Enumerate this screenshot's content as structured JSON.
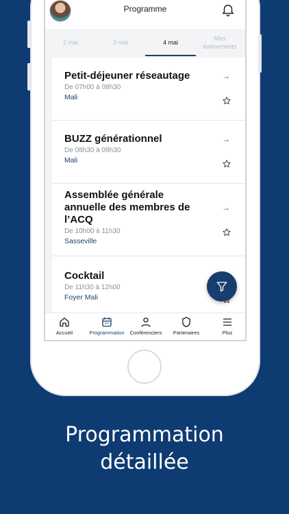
{
  "header": {
    "title": "Programme",
    "avatar": "avatar",
    "notification_icon": "bell-icon"
  },
  "tabs": [
    {
      "label": "2 mai",
      "active": false
    },
    {
      "label": "3 mai",
      "active": false
    },
    {
      "label": "4 mai",
      "active": true
    },
    {
      "label": "Mes événements",
      "active": false
    }
  ],
  "events": [
    {
      "title": "Petit-déjeuner réseautage",
      "time": "De 07h00 à 08h30",
      "location": "Mali"
    },
    {
      "title": "BUZZ générationnel",
      "time": "De 08h30 à 09h30",
      "location": "Mali"
    },
    {
      "title": "Assemblée générale annuelle des membres de l’ACQ",
      "time": "De 10h00 à 11h30",
      "location": "Sasseville"
    },
    {
      "title": "Cocktail",
      "time": "De 11h30 à 12h00",
      "location": "Foyer Mali"
    }
  ],
  "event_arrow": "→",
  "bottom_nav": [
    {
      "label": "Accueil",
      "icon": "home-icon",
      "active": false
    },
    {
      "label": "Programmation",
      "icon": "calendar-icon",
      "active": true
    },
    {
      "label": "Conférenciers",
      "icon": "person-icon",
      "active": false
    },
    {
      "label": "Partenaires",
      "icon": "shield-icon",
      "active": false
    },
    {
      "label": "Plus",
      "icon": "menu-icon",
      "active": false
    }
  ],
  "caption": {
    "line1": "Programmation",
    "line2": "détaillée"
  },
  "colors": {
    "background": "#0f3b73",
    "accent": "#1f3f6b",
    "fab": "#173e6f"
  }
}
